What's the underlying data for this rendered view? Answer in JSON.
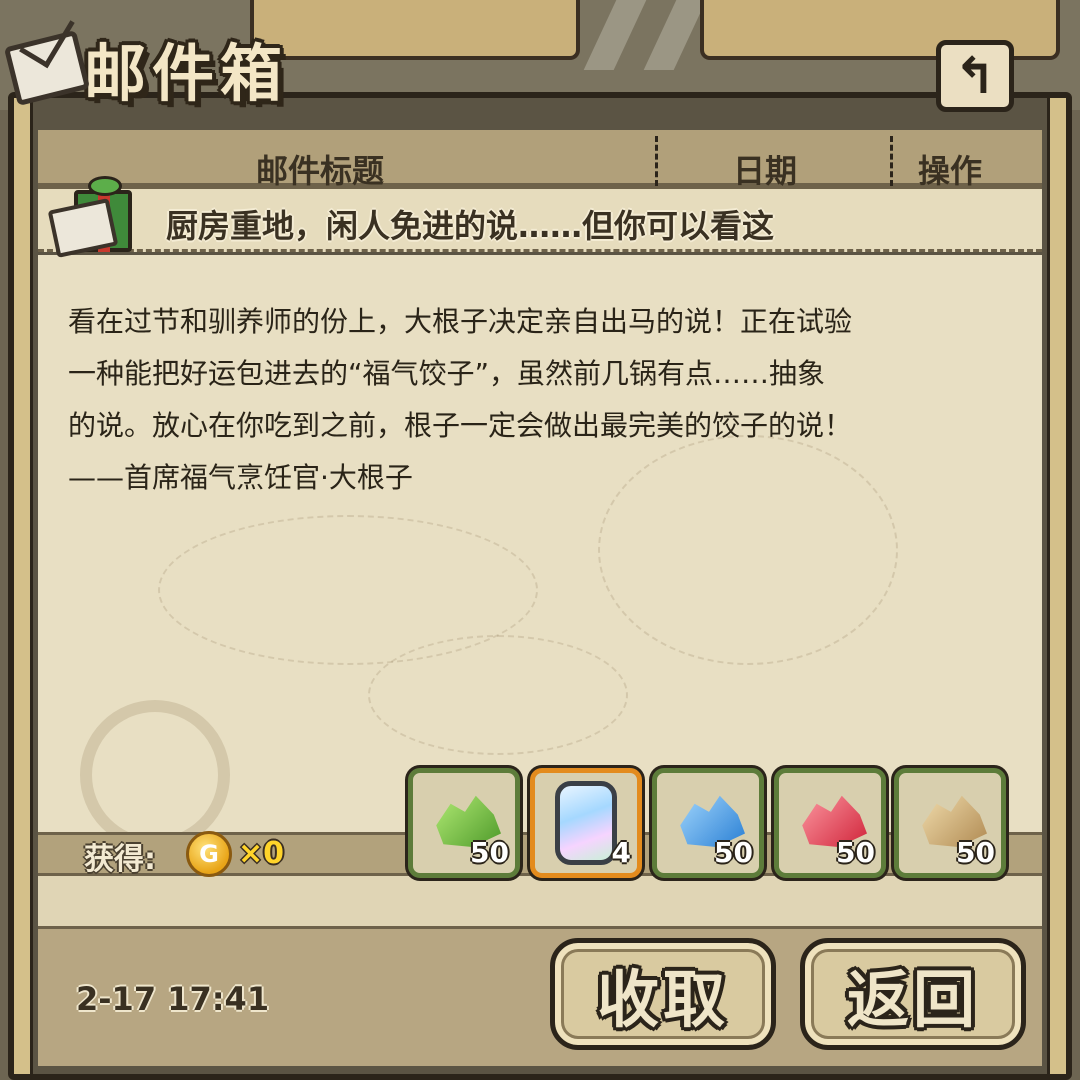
{
  "header": {
    "title": "邮件箱",
    "back_icon": "return-arrow-icon"
  },
  "columns": {
    "subject": "邮件标题",
    "date": "日期",
    "action": "操作"
  },
  "mail": {
    "subject": "厨房重地，闲人免进的说……但你可以看这",
    "body_lines": [
      "看在过节和驯养师的份上，大根子决定亲自出马的说！正在试验",
      "一种能把好运包进去的“福气饺子”，虽然前几锅有点……抽象",
      "的说。放心在你吃到之前，根子一定会做出最完美的饺子的说！",
      "——首席福气烹饪官·大根子"
    ],
    "date": "2-17 17:41"
  },
  "rewards": {
    "label": "获得:",
    "coin_symbol": "G",
    "coin_count": "×0",
    "items": [
      {
        "name": "green-crystal",
        "qty": "50",
        "frame": "#5d7c3a"
      },
      {
        "name": "capsule",
        "qty": "4",
        "frame": "#e38b1d"
      },
      {
        "name": "blue-crystal",
        "qty": "50",
        "frame": "#5d7c3a"
      },
      {
        "name": "red-crystal",
        "qty": "50",
        "frame": "#5d7c3a"
      },
      {
        "name": "tan-crystal",
        "qty": "50",
        "frame": "#5d7c3a"
      }
    ]
  },
  "buttons": {
    "collect": "收取",
    "back": "返回"
  },
  "colors": {
    "paper": "#e8dfc3",
    "frame": "#2b241a",
    "coin_text": "#ffd42a"
  }
}
